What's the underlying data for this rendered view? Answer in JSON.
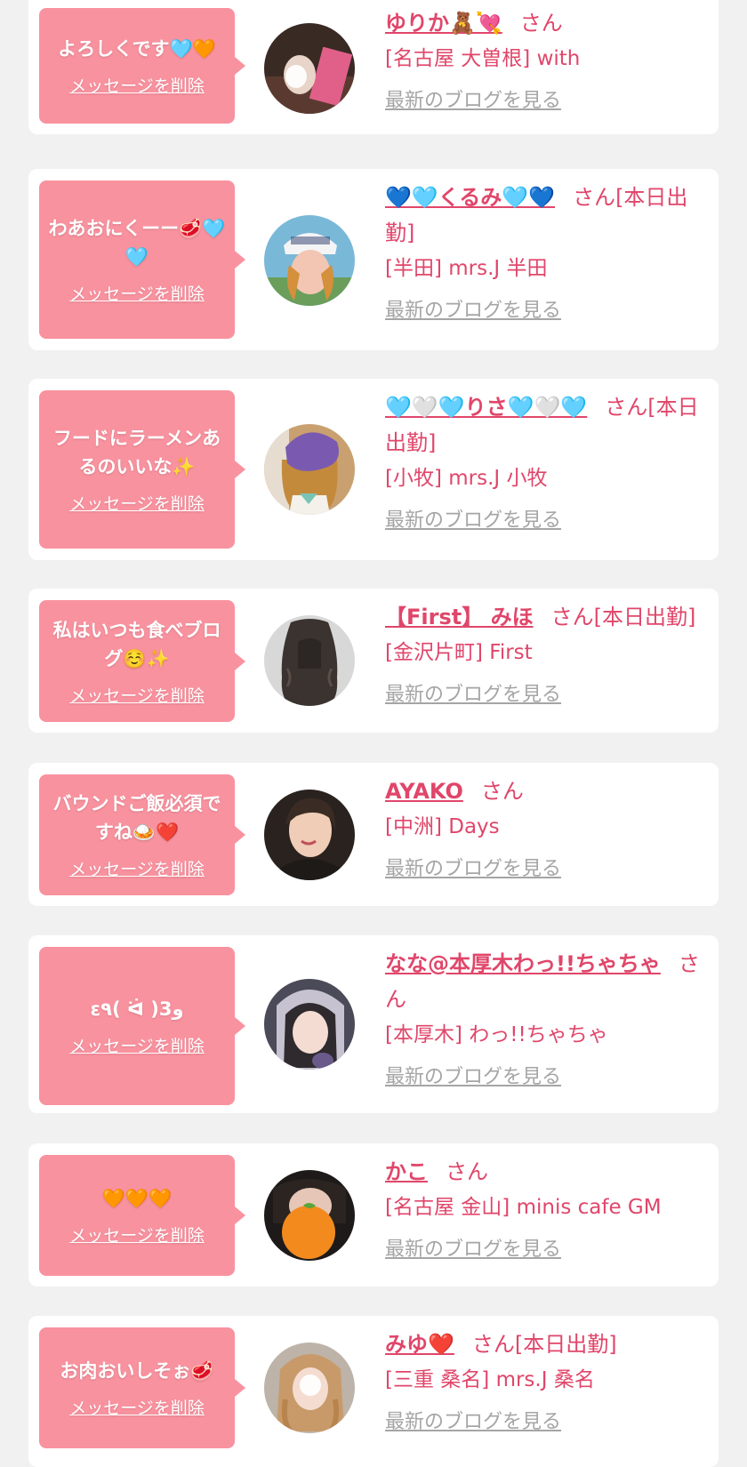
{
  "delete_label": "メッセージを削除",
  "blog_label": "最新のブログを見る",
  "honorific": "さん",
  "colors": {
    "background": "#f1f1f1",
    "card": "#ffffff",
    "bubble": "#f9929f",
    "accent_text": "#e0466a",
    "muted_link": "#a5a5a5"
  },
  "entries": [
    {
      "message": "よろしくです🩵🧡",
      "name": "ゆりか🧸💘",
      "status": "",
      "shop": "[名古屋 大曽根] with",
      "avatar_icon": "profile-photo-icon"
    },
    {
      "message": "わあおにくーー🥩🩵🩵",
      "name": "💙🩵くるみ🩵💙",
      "status": "[本日出勤]",
      "shop": "[半田] mrs.J 半田",
      "avatar_icon": "profile-photo-icon"
    },
    {
      "message": "フードにラーメンあるのいいな✨",
      "name": "🩵🤍🩵りさ🩵🤍🩵",
      "status": "[本日出勤]",
      "shop": "[小牧] mrs.J 小牧",
      "avatar_icon": "profile-photo-icon"
    },
    {
      "message": "私はいつも食べブログ☺️✨",
      "name": "【First】 みほ",
      "status": "[本日出勤]",
      "shop": "[金沢片町] First",
      "avatar_icon": "profile-photo-icon"
    },
    {
      "message": "バウンドご飯必須ですね🍛❤️",
      "name": "AYAKO",
      "status": "",
      "shop": "[中洲] Days",
      "avatar_icon": "profile-photo-icon"
    },
    {
      "message": "ε٩( ᐛ )و3",
      "name": "なな@本厚木わっ!!ちゃちゃ",
      "status": "",
      "shop": "[本厚木] わっ!!ちゃちゃ",
      "avatar_icon": "profile-photo-icon"
    },
    {
      "message": "🧡🧡🧡",
      "name": "かこ",
      "status": "",
      "shop": "[名古屋 金山] minis cafe GM",
      "avatar_icon": "profile-photo-icon"
    },
    {
      "message": "お肉おいしそぉ🥩",
      "name": "みゆ❤️",
      "status": "[本日出勤]",
      "shop": "[三重 桑名] mrs.J 桑名",
      "avatar_icon": "profile-photo-icon"
    }
  ]
}
